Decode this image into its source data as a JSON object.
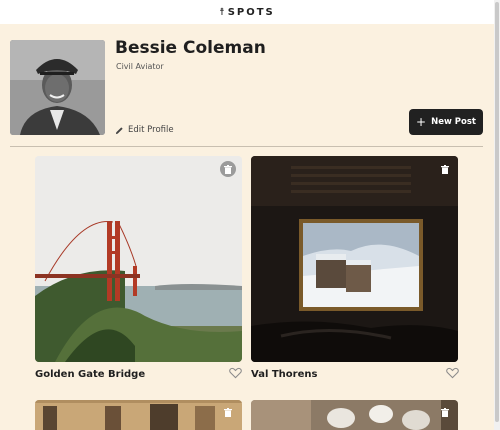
{
  "header": {
    "logo_text": "SPOTS",
    "logo_mark": "☨"
  },
  "profile": {
    "name": "Bessie Coleman",
    "job": "Civil Aviator",
    "edit_label": "Edit Profile",
    "new_post_label": "New Post",
    "new_post_icon": "+"
  },
  "cards": [
    {
      "title": "Golden Gate Bridge",
      "liked": false
    },
    {
      "title": "Val Thorens",
      "liked": false
    }
  ],
  "colors": {
    "background": "#fbf1e0",
    "button": "#212121",
    "text": "#212121"
  },
  "icons": [
    "logo-icon",
    "pencil-icon",
    "plus-icon",
    "trash-icon",
    "heart-icon"
  ]
}
